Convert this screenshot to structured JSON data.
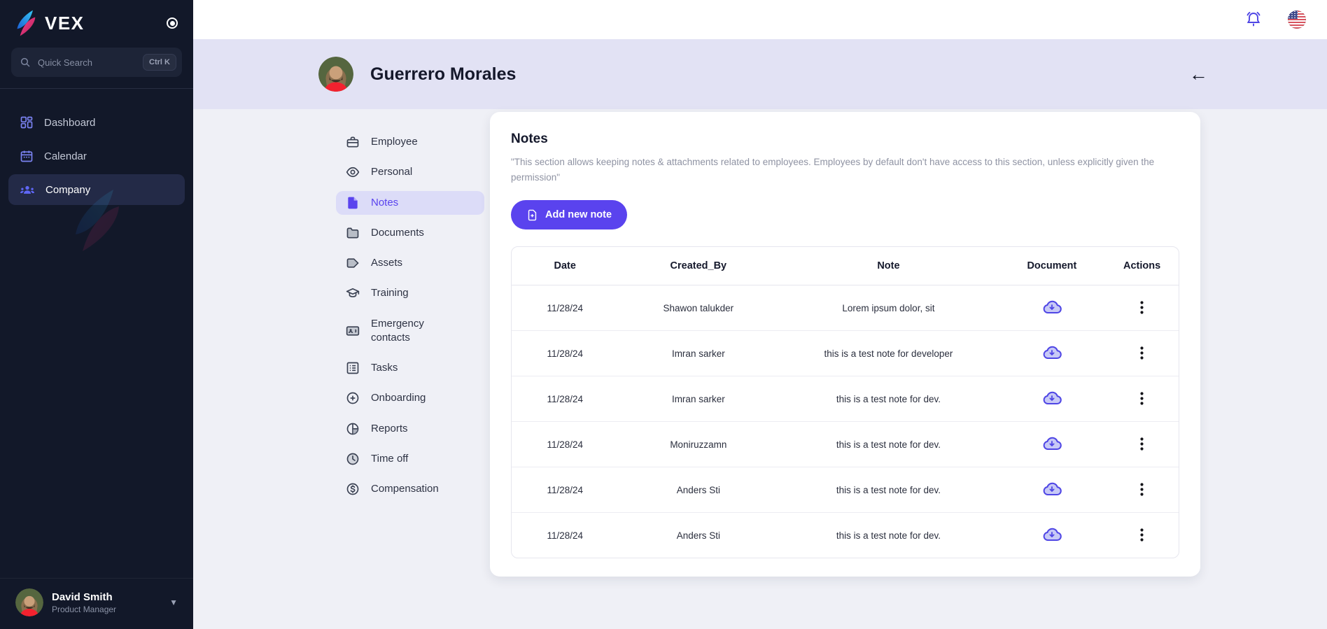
{
  "colors": {
    "accent": "#5a43ee",
    "sidebar_bg": "#121829",
    "header_band": "#e2e2f4",
    "content_bg": "#eff0f6",
    "active_pill": "#dcdcf8",
    "icon_indigo": "#4f46e5",
    "logo_blue": "#35c7f4",
    "logo_pink": "#f43f8e"
  },
  "sidebar": {
    "logo_text": "VEX",
    "search": {
      "placeholder": "Quick Search",
      "shortcut": "Ctrl K"
    },
    "items": [
      {
        "label": "Dashboard",
        "icon": "dashboard-grid-icon",
        "active": false
      },
      {
        "label": "Calendar",
        "icon": "calendar-icon",
        "active": false
      },
      {
        "label": "Company",
        "icon": "company-people-icon",
        "active": true
      }
    ],
    "user": {
      "name": "David Smith",
      "role": "Product Manager"
    }
  },
  "header": {
    "title": "Guerrero Morales",
    "back_icon": "back-arrow-icon"
  },
  "topbar": {
    "icons": [
      "notification-bell-icon",
      "language-flag-us-icon"
    ]
  },
  "profile_menu": {
    "items": [
      {
        "label": "Employee",
        "icon": "briefcase-icon",
        "active": false
      },
      {
        "label": "Personal",
        "icon": "eye-icon",
        "active": false
      },
      {
        "label": "Notes",
        "icon": "note-file-icon",
        "active": true
      },
      {
        "label": "Documents",
        "icon": "folder-icon",
        "active": false
      },
      {
        "label": "Assets",
        "icon": "tag-icon",
        "active": false
      },
      {
        "label": "Training",
        "icon": "graduation-cap-icon",
        "active": false
      },
      {
        "label": "Emergency contacts",
        "icon": "contact-card-icon",
        "active": false
      },
      {
        "label": "Tasks",
        "icon": "task-list-icon",
        "active": false
      },
      {
        "label": "Onboarding",
        "icon": "plus-circle-icon",
        "active": false
      },
      {
        "label": "Reports",
        "icon": "pie-chart-icon",
        "active": false
      },
      {
        "label": "Time off",
        "icon": "clock-icon",
        "active": false
      },
      {
        "label": "Compensation",
        "icon": "dollar-circle-icon",
        "active": false
      }
    ]
  },
  "notes": {
    "title": "Notes",
    "description": "\"This section allows keeping notes & attachments related to employees. Employees by default don't have access to this section, unless explicitly given the permission\"",
    "add_button_label": "Add new note",
    "table": {
      "columns": [
        "Date",
        "Created_By",
        "Note",
        "Document",
        "Actions"
      ],
      "rows": [
        {
          "date": "11/28/24",
          "created_by": "Shawon talukder",
          "note": "Lorem ipsum dolor, sit"
        },
        {
          "date": "11/28/24",
          "created_by": "Imran sarker",
          "note": "this is a test note for developer"
        },
        {
          "date": "11/28/24",
          "created_by": "Imran sarker",
          "note": "this is a test note for dev."
        },
        {
          "date": "11/28/24",
          "created_by": "Moniruzzamn",
          "note": "this is a test note for dev."
        },
        {
          "date": "11/28/24",
          "created_by": "Anders Sti",
          "note": "this is a test note for dev."
        },
        {
          "date": "11/28/24",
          "created_by": "Anders Sti",
          "note": "this is a test note for dev."
        }
      ]
    }
  }
}
